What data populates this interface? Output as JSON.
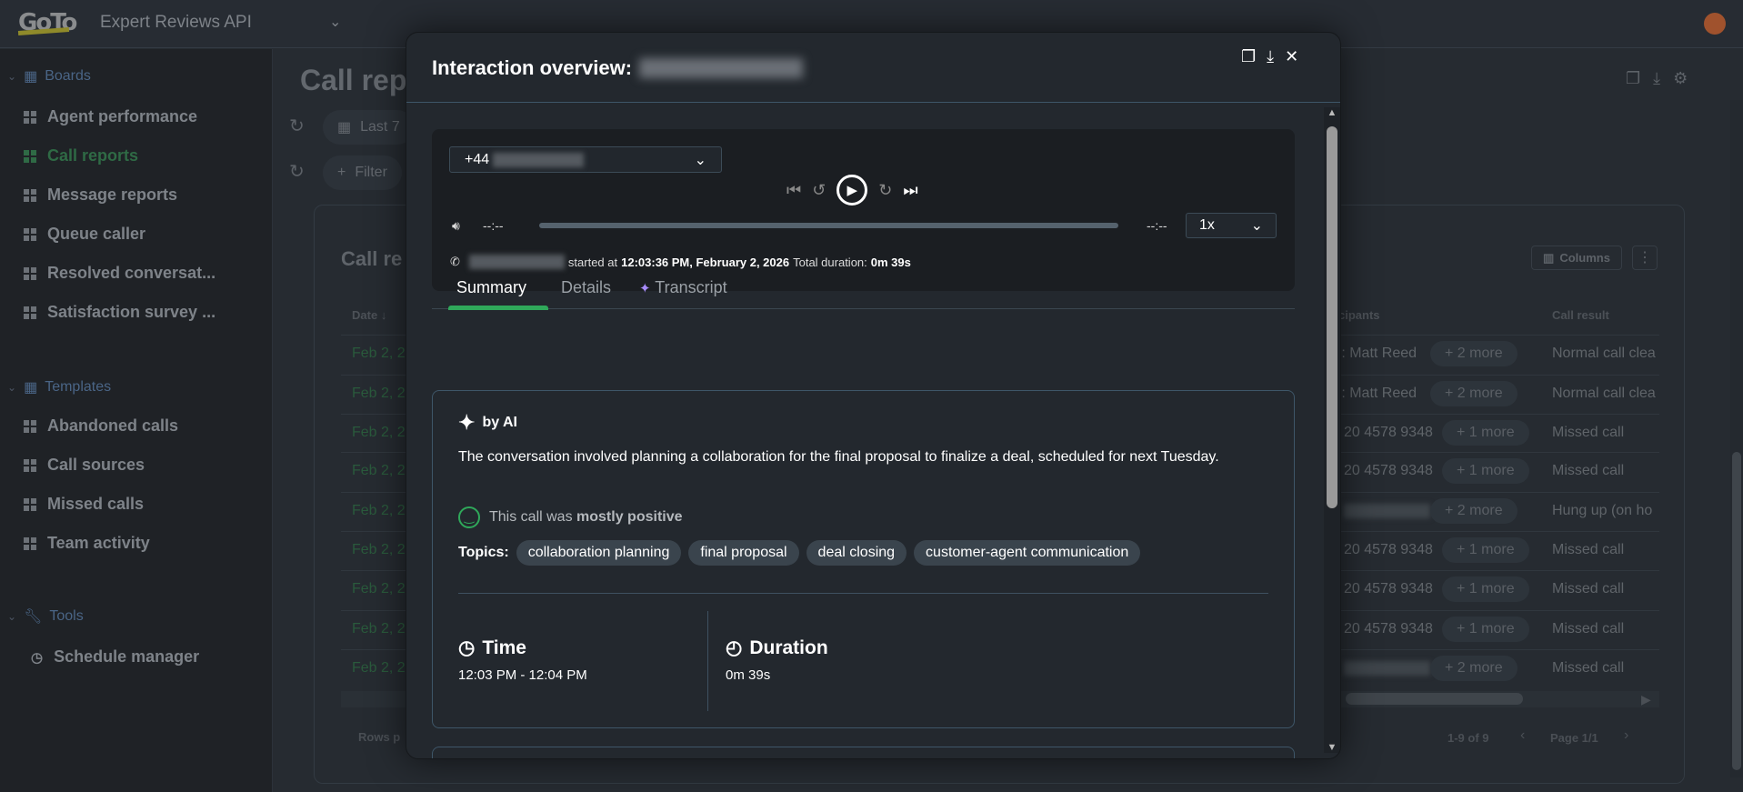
{
  "header": {
    "logo": "GoTo",
    "app_name": "Expert Reviews API"
  },
  "sidebar": {
    "sections": [
      {
        "label": "Boards",
        "items": [
          "Agent performance",
          "Call reports",
          "Message reports",
          "Queue caller",
          "Resolved conversat...",
          "Satisfaction survey ..."
        ]
      },
      {
        "label": "Templates",
        "items": [
          "Abandoned calls",
          "Call sources",
          "Missed calls",
          "Team activity"
        ]
      },
      {
        "label": "Tools",
        "items": [
          "Schedule manager"
        ]
      }
    ],
    "active": "Call reports"
  },
  "page": {
    "title": "Call rep",
    "date_filter": "Last 7",
    "filter_label": "Filter",
    "card_title": "Call re",
    "columns_label": "Columns",
    "headers": {
      "date": "Date",
      "participants": "cipants",
      "call_result": "Call result"
    },
    "rows": [
      {
        "date": "Feb 2, 2",
        "participant": "): Matt Reed",
        "more": "+ 2 more",
        "result": "Normal call clea",
        "blurred": false
      },
      {
        "date": "Feb 2, 2",
        "participant": "): Matt Reed",
        "more": "+ 2 more",
        "result": "Normal call clea",
        "blurred": false
      },
      {
        "date": "Feb 2, 2",
        "participant": "20 4578 9348",
        "more": "+ 1 more",
        "result": "Missed call",
        "blurred": false
      },
      {
        "date": "Feb 2, 2",
        "participant": "20 4578 9348",
        "more": "+ 1 more",
        "result": "Missed call",
        "blurred": false
      },
      {
        "date": "Feb 2, 2",
        "participant": "",
        "more": "+ 2 more",
        "result": "Hung up (on ho",
        "blurred": true
      },
      {
        "date": "Feb 2, 2",
        "participant": "20 4578 9348",
        "more": "+ 1 more",
        "result": "Missed call",
        "blurred": false
      },
      {
        "date": "Feb 2, 2",
        "participant": "20 4578 9348",
        "more": "+ 1 more",
        "result": "Missed call",
        "blurred": false
      },
      {
        "date": "Feb 2, 2",
        "participant": "20 4578 9348",
        "more": "+ 1 more",
        "result": "Missed call",
        "blurred": false
      },
      {
        "date": "Feb 2, 2",
        "participant": "",
        "more": "+ 2 more",
        "result": "Missed call",
        "blurred": true
      }
    ],
    "footer": {
      "rows_per_page": "Rows p",
      "range": "1-9 of 9",
      "page": "Page 1/1"
    }
  },
  "modal": {
    "title": "Interaction overview:",
    "player": {
      "number_prefix": "+44",
      "time_current": "--:--",
      "time_total": "--:--",
      "speed": "1x",
      "progress": 0,
      "started_label": "started at",
      "started_at": "12:03:36 PM, February 2, 2026",
      "duration_label": "Total duration:",
      "duration": "0m 39s"
    },
    "tabs": [
      "Summary",
      "Details",
      "Transcript"
    ],
    "active_tab": "Summary",
    "summary": {
      "by_ai": "by AI",
      "text": "The conversation involved planning a collaboration for the final proposal to finalize a deal, scheduled for next Tuesday.",
      "sentiment_prefix": "This call was",
      "sentiment": "mostly positive",
      "topics_label": "Topics:",
      "topics": [
        "collaboration planning",
        "final proposal",
        "deal closing",
        "customer-agent communication"
      ],
      "time_label": "Time",
      "time_value": "12:03 PM - 12:04 PM",
      "duration_label": "Duration",
      "duration_value": "0m 39s"
    }
  },
  "colors": {
    "accent": "#2fa85a",
    "ai": "#a78bfa"
  }
}
